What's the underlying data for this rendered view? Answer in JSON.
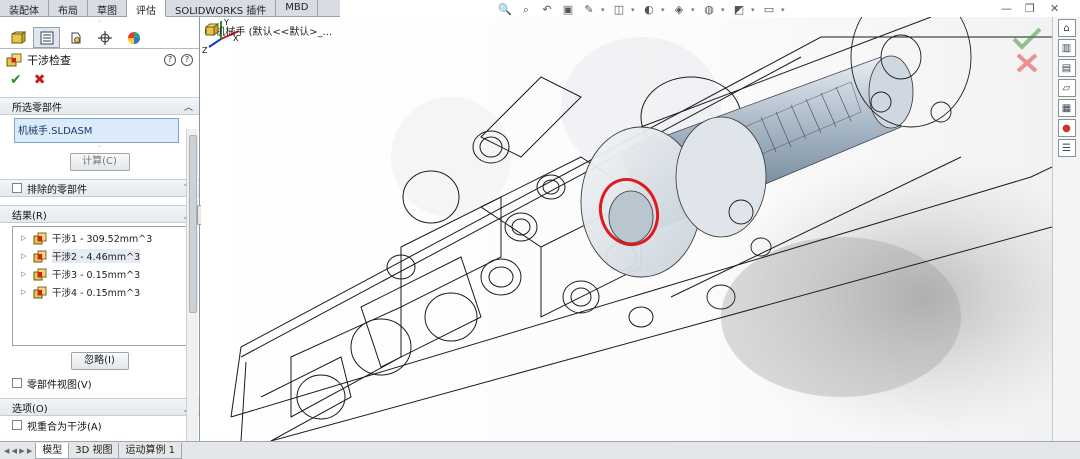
{
  "command_tabs": [
    "装配体",
    "布局",
    "草图",
    "评估",
    "SOLIDWORKS 插件",
    "MBD"
  ],
  "active_command_tab": "评估",
  "manager_tabs": [
    {
      "icon": "feature-manager-icon"
    },
    {
      "icon": "property-manager-icon"
    },
    {
      "icon": "configuration-manager-icon"
    },
    {
      "icon": "dimxpert-manager-icon"
    },
    {
      "icon": "display-manager-icon"
    }
  ],
  "property_manager": {
    "title": "干涉检查",
    "help_glyph": "?",
    "info_glyph": "?",
    "ok_glyph": "✔",
    "cancel_glyph": "✖"
  },
  "selected_components": {
    "header": "所选零部件",
    "value": "机械手.SLDASM",
    "calculate_button": "计算(C)"
  },
  "excluded_components": {
    "header": "排除的零部件"
  },
  "results": {
    "header": "结果(R)",
    "items": [
      {
        "label": "干涉1 - 309.52mm^3"
      },
      {
        "label": "干涉2 - 4.46mm^3"
      },
      {
        "label": "干涉3 - 0.15mm^3"
      },
      {
        "label": "干涉4 - 0.15mm^3"
      }
    ],
    "ignore_button": "忽略(I)",
    "component_view_label": "零部件视图(V)"
  },
  "options": {
    "header": "选项(O)",
    "first_option_label": "视重合为干涉(A)"
  },
  "breadcrumb": {
    "text": "机械手  (默认<<默认>_..."
  },
  "bottom_tabs": [
    "模型",
    "3D 视图",
    "运动算例 1"
  ],
  "active_bottom_tab": "模型",
  "nav_arrows": "◀ ◀ ▶ ▶",
  "triad_labels": {
    "x": "X",
    "y": "Y",
    "z": "Z"
  },
  "colors": {
    "accent_red": "#e0191f",
    "ok_green": "#2e8b2e",
    "panel_border": "#8c949c",
    "selection_blue": "#dcebfa"
  }
}
